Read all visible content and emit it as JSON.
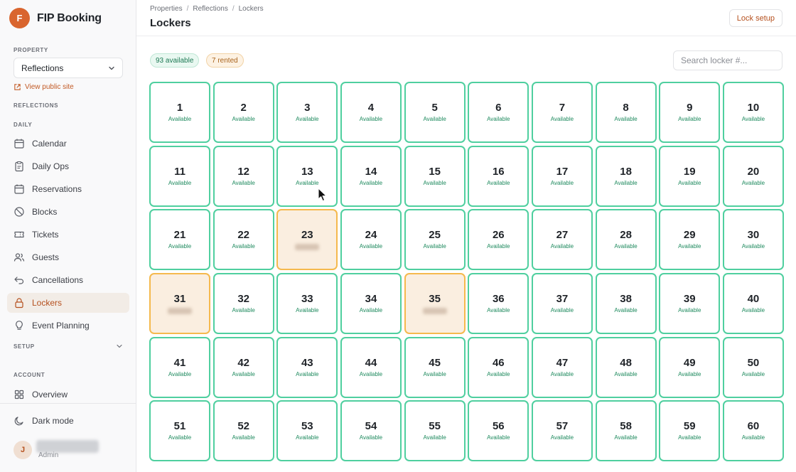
{
  "brand": {
    "initial": "F",
    "name": "FIP Booking"
  },
  "sidebar": {
    "property_label": "PROPERTY",
    "property_value": "Reflections",
    "view_public_label": "View public site",
    "property_section_label": "REFLECTIONS",
    "daily_label": "DAILY",
    "items": [
      {
        "label": "Calendar",
        "icon": "calendar-icon"
      },
      {
        "label": "Daily Ops",
        "icon": "clipboard-icon"
      },
      {
        "label": "Reservations",
        "icon": "calendar-icon"
      },
      {
        "label": "Blocks",
        "icon": "ban-icon"
      },
      {
        "label": "Tickets",
        "icon": "ticket-icon"
      },
      {
        "label": "Guests",
        "icon": "users-icon"
      },
      {
        "label": "Cancellations",
        "icon": "undo-icon"
      },
      {
        "label": "Lockers",
        "icon": "lock-icon",
        "active": true
      },
      {
        "label": "Event Planning",
        "icon": "lightbulb-icon"
      }
    ],
    "setup_label": "SETUP",
    "account_label": "ACCOUNT",
    "overview_label": "Overview",
    "dark_mode_label": "Dark mode",
    "user": {
      "initial": "J",
      "role": "Admin"
    }
  },
  "header": {
    "breadcrumb": [
      "Properties",
      "Reflections",
      "Lockers"
    ],
    "title": "Lockers",
    "lock_setup_label": "Lock setup"
  },
  "toolbar": {
    "available_badge": "93 available",
    "rented_badge": "7 rented",
    "search_placeholder": "Search locker #..."
  },
  "lockers": {
    "available_label": "Available",
    "rented": [
      23,
      31,
      35
    ],
    "visible_count": 60
  },
  "colors": {
    "accent": "#c25a25",
    "available_border": "#4fcf9f",
    "rented_border": "#f5b94d",
    "rented_fill": "#faeee0"
  }
}
